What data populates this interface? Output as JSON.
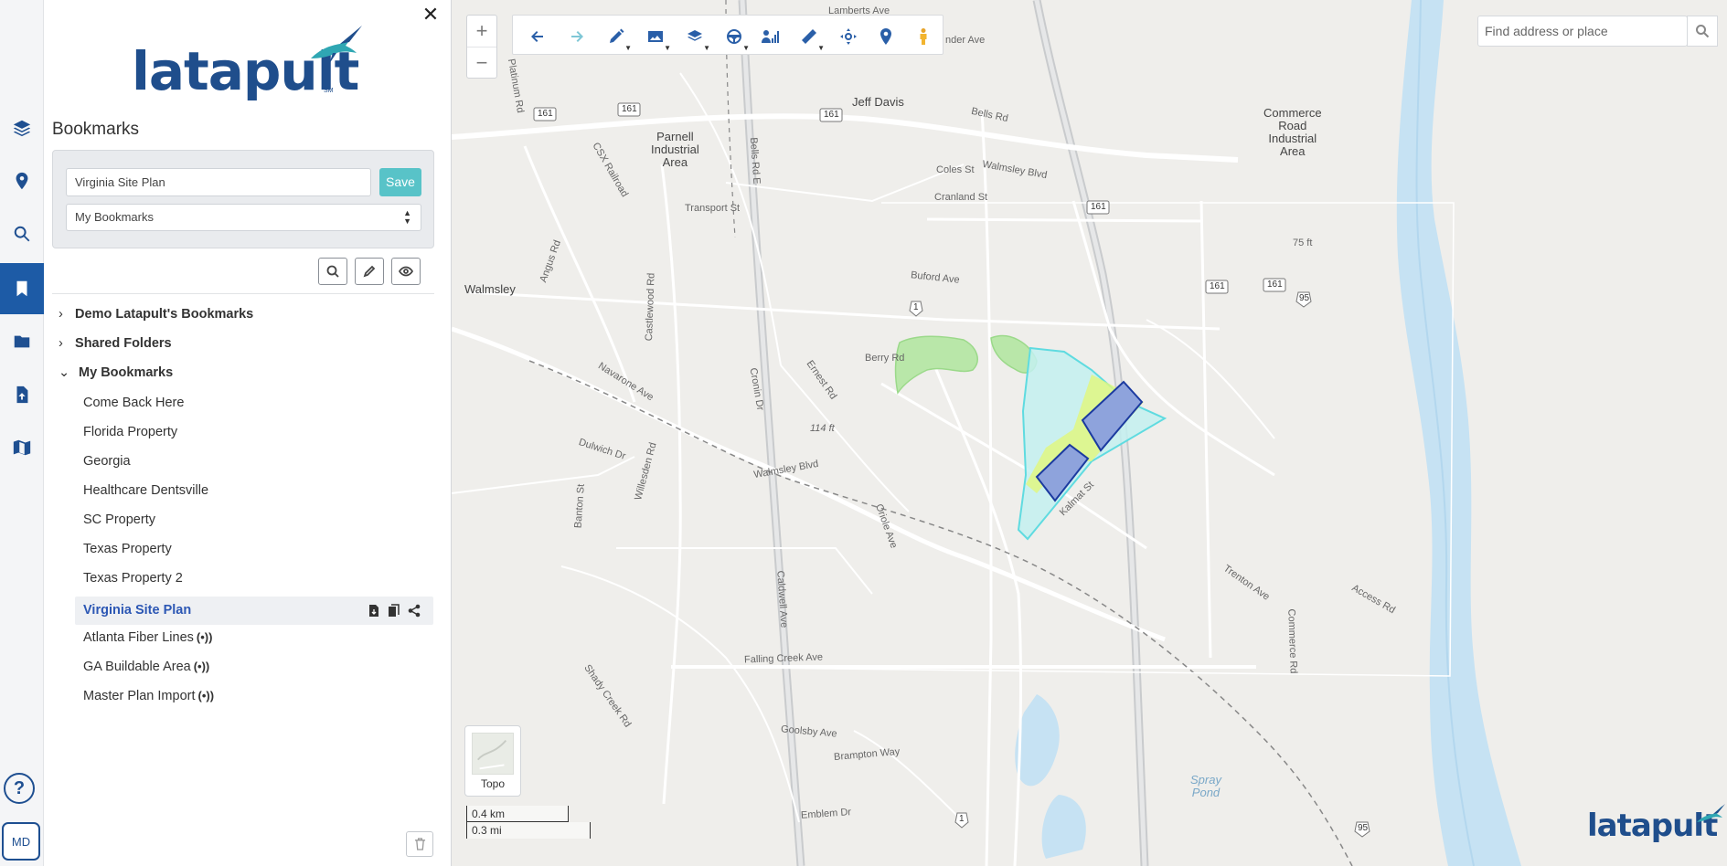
{
  "panel": {
    "close_glyph": "✕",
    "logo_text": "latapult",
    "logo_tm": "SM",
    "title": "Bookmarks",
    "name_value": "Virginia Site Plan",
    "save_label": "Save",
    "folder_value": "My Bookmarks",
    "tree": {
      "folders": [
        {
          "label": "Demo Latapult's Bookmarks",
          "expanded": false
        },
        {
          "label": "Shared Folders",
          "expanded": false
        },
        {
          "label": "My Bookmarks",
          "expanded": true
        }
      ],
      "items": [
        {
          "label": "Come Back Here"
        },
        {
          "label": "Florida Property"
        },
        {
          "label": "Georgia"
        },
        {
          "label": "Healthcare Dentsville"
        },
        {
          "label": "SC Property"
        },
        {
          "label": "Texas Property"
        },
        {
          "label": "Texas Property 2"
        },
        {
          "label": "Virginia Site Plan",
          "active": true
        },
        {
          "label": "Atlanta Fiber Lines",
          "live": true
        },
        {
          "label": "GA Buildable Area",
          "live": true
        },
        {
          "label": "Master Plan Import",
          "live": true
        }
      ]
    },
    "signal_glyph": "(•))"
  },
  "rail": {
    "help_label": "?",
    "user_initials": "MD"
  },
  "map": {
    "zoom_in": "+",
    "zoom_out": "−",
    "search_placeholder": "Find address or place",
    "basemap_label": "Topo",
    "scale_km": "0.4 km",
    "scale_mi": "0.3 mi",
    "logo_text": "latapult",
    "places": [
      "Jeff Davis",
      "Parnell\nIndustrial\nArea",
      "Commerce\nRoad\nIndustrial\nArea",
      "Walmsley",
      "Spray\nPond"
    ],
    "roads": [
      "Lamberts Ave",
      "nder Ave",
      "Bells Rd",
      "Platinum Rd",
      "CSX Railroad",
      "Bells Rd E",
      "Coles St",
      "Transport St",
      "Cranland St",
      "Buford Ave",
      "Angus Rd",
      "Berry Rd",
      "Navarone Ave",
      "Ernest Rd",
      "Cronin Dr",
      "Castlewood Rd",
      "Dulwich Dr",
      "Willesden Rd",
      "Walmsley Blvd",
      "Banton St",
      "Oriole Ave",
      "Caldwell Ave",
      "Kalmat St",
      "Trenton Ave",
      "Access Rd",
      "Commerce Rd",
      "Falling Creek Ave",
      "Shady Creek Rd",
      "Goolsby Ave",
      "Brampton Way",
      "Emblem Dr",
      "Walmsley Blvd",
      "75 ft",
      "114 ft"
    ],
    "shields": [
      "161",
      "161",
      "161",
      "161",
      "161",
      "161",
      "1",
      "1",
      "95",
      "95"
    ]
  },
  "colors": {
    "brand": "#1f4e8c",
    "accent_teal": "#58c3c8",
    "active_link": "#2c57b4",
    "rail_active": "#1d5ba6",
    "water": "#c6e2f3",
    "parcel_fill": "#c3f0f0",
    "building_fill": "#8ea3dc"
  }
}
